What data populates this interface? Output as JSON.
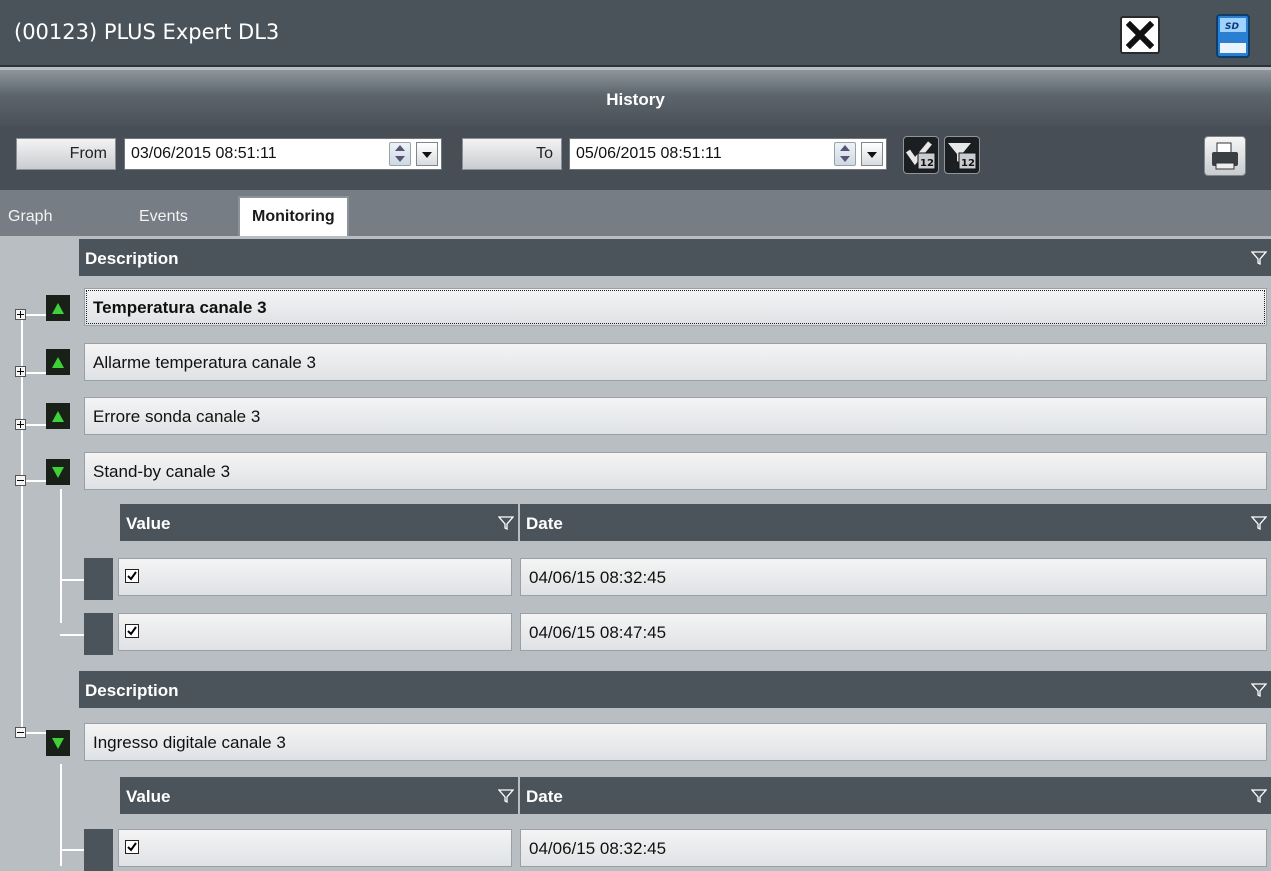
{
  "window": {
    "title": "(00123) PLUS Expert DL3",
    "close_icon": "close-x-icon",
    "device_icon": "sd-card-icon"
  },
  "section": {
    "title": "History"
  },
  "filter": {
    "from_label": "From",
    "from_value": "03/06/2015 08:51:11",
    "to_label": "To",
    "to_value": "05/06/2015 08:51:11",
    "icons": [
      "check-calendar-12-icon",
      "filter-calendar-12-icon",
      "printer-icon"
    ]
  },
  "tabs": [
    {
      "label": "Graph",
      "active": false
    },
    {
      "label": "Events",
      "active": false
    },
    {
      "label": "Monitoring",
      "active": true
    }
  ],
  "headers": {
    "description": "Description",
    "value": "Value",
    "date": "Date"
  },
  "groups": [
    {
      "label": "Temperatura canale 3",
      "state": "collapsed",
      "selected": true
    },
    {
      "label": "Allarme temperatura canale 3",
      "state": "collapsed"
    },
    {
      "label": "Errore sonda canale 3",
      "state": "collapsed"
    },
    {
      "label": "Stand-by canale 3",
      "state": "expanded",
      "rows": [
        {
          "checked": true,
          "date": "04/06/15 08:32:45"
        },
        {
          "checked": true,
          "date": "04/06/15 08:47:45"
        }
      ]
    },
    {
      "label": "Ingresso digitale canale 3",
      "state": "expanded",
      "rows": [
        {
          "checked": true,
          "date": "04/06/15 08:32:45"
        }
      ]
    }
  ],
  "colors": {
    "header_bg": "#4c545b",
    "expand_indicator": "#3fd13a",
    "toolbar_bg": "#474e55"
  }
}
